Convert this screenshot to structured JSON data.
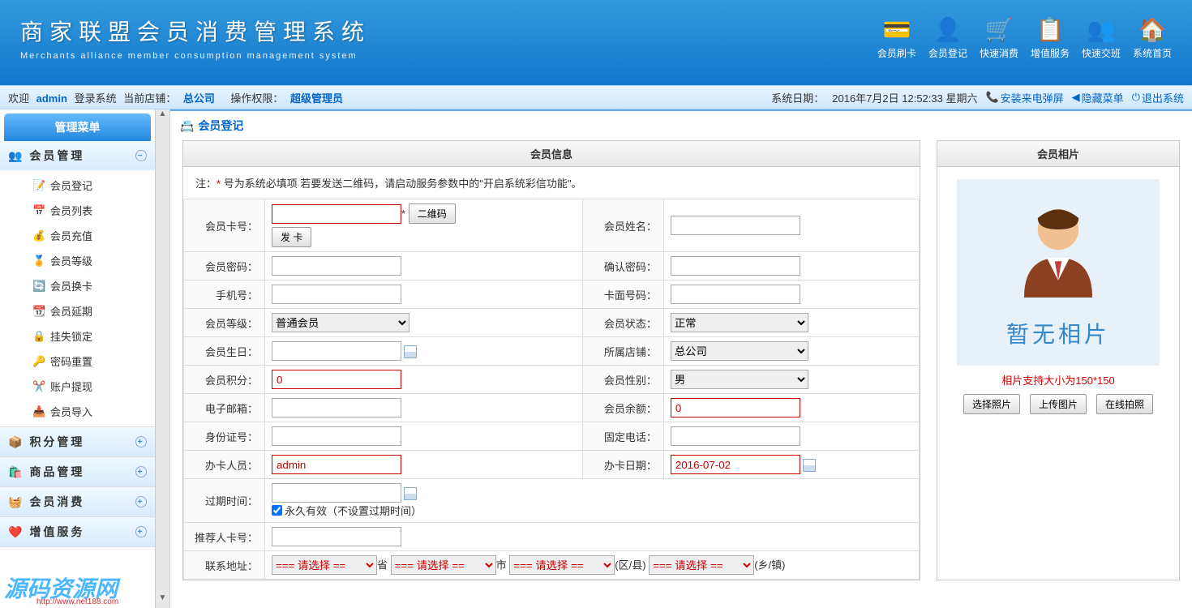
{
  "header": {
    "title": "商家联盟会员消费管理系统",
    "subtitle": "Merchants alliance member consumption management system",
    "nav": [
      {
        "label": "会员刷卡",
        "icon": "💳"
      },
      {
        "label": "会员登记",
        "icon": "👤"
      },
      {
        "label": "快速消费",
        "icon": "🛒"
      },
      {
        "label": "增值服务",
        "icon": "📋"
      },
      {
        "label": "快速交班",
        "icon": "👥"
      },
      {
        "label": "系统首页",
        "icon": "🏠"
      }
    ]
  },
  "infobar": {
    "welcome": "欢迎",
    "user": "admin",
    "login_sys": "登录系统",
    "curr_shop_label": "当前店铺：",
    "curr_shop": "总公司",
    "perm_label": "操作权限：",
    "perm": "超级管理员",
    "sysdate_label": "系统日期：",
    "sysdate": "2016年7月2日 12:52:33 星期六",
    "install": "安装来电弹屏",
    "hide_menu": "隐藏菜单",
    "logout": "退出系统"
  },
  "sidebar": {
    "title": "管理菜单",
    "groups": [
      {
        "title": "会员管理",
        "expanded": true,
        "icon": "👥",
        "items": [
          {
            "label": "会员登记",
            "icon": "📝"
          },
          {
            "label": "会员列表",
            "icon": "📅"
          },
          {
            "label": "会员充值",
            "icon": "💰"
          },
          {
            "label": "会员等级",
            "icon": "🏅"
          },
          {
            "label": "会员换卡",
            "icon": "🔄"
          },
          {
            "label": "会员延期",
            "icon": "📆"
          },
          {
            "label": "挂失锁定",
            "icon": "🔒"
          },
          {
            "label": "密码重置",
            "icon": "🔑"
          },
          {
            "label": "账户提现",
            "icon": "✂️"
          },
          {
            "label": "会员导入",
            "icon": "📥"
          }
        ]
      },
      {
        "title": "积分管理",
        "expanded": false,
        "icon": "📦"
      },
      {
        "title": "商品管理",
        "expanded": false,
        "icon": "🛍️"
      },
      {
        "title": "会员消费",
        "expanded": false,
        "icon": "🧺"
      },
      {
        "title": "增值服务",
        "expanded": false,
        "icon": "❤️"
      }
    ]
  },
  "content": {
    "title": "会员登记",
    "section_member_info": "会员信息",
    "section_photo": "会员相片",
    "note_prefix": "注：",
    "note_star": "*",
    "note_text": " 号为系统必填项   若要发送二维码，请启动服务参数中的\"开启系统彩信功能\"。",
    "labels": {
      "card_no": "会员卡号：",
      "qrcode_btn": "二维码",
      "issue_btn": "发  卡",
      "name": "会员姓名：",
      "pwd": "会员密码：",
      "pwd2": "确认密码：",
      "phone": "手机号：",
      "card_face": "卡面号码：",
      "level": "会员等级：",
      "status": "会员状态：",
      "birthday": "会员生日：",
      "shop": "所属店铺：",
      "points": "会员积分：",
      "gender": "会员性别：",
      "email": "电子邮箱：",
      "balance": "会员余额：",
      "idcard": "身份证号：",
      "fixed_tel": "固定电话：",
      "operator": "办卡人员：",
      "card_date": "办卡日期：",
      "expire": "过期时间：",
      "forever": "永久有效（不设置过期时间）",
      "referrer": "推荐人卡号：",
      "address": "联系地址："
    },
    "values": {
      "level": "普通会员",
      "status": "正常",
      "shop": "总公司",
      "points": "0",
      "gender": "男",
      "balance": "0",
      "operator": "admin",
      "card_date": "2016-07-02",
      "addr_placeholder": "=== 请选择 ==",
      "addr_suffix": [
        "省",
        "市",
        "(区/县)",
        "(乡/镇)"
      ]
    },
    "photo": {
      "no_photo": "暂无相片",
      "size_note": "相片支持大小为150*150",
      "btn_select": "选择照片",
      "btn_upload": "上传图片",
      "btn_capture": "在线拍照"
    }
  },
  "watermark": {
    "text": "源码资源网",
    "url": "http://www.net188.com"
  }
}
